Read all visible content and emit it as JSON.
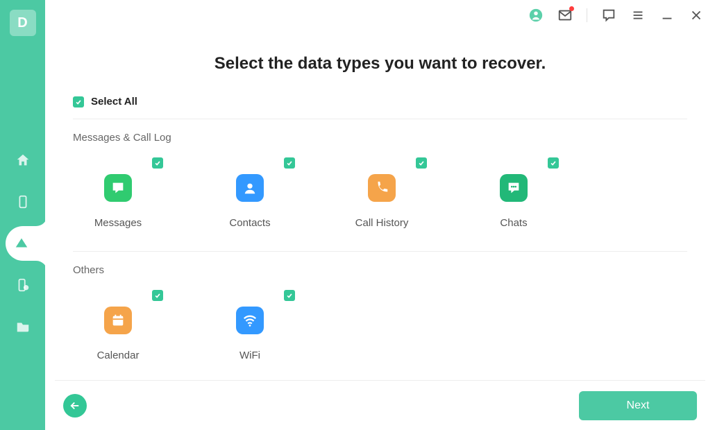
{
  "logo": "D",
  "page_title": "Select the data types you want to recover.",
  "select_all_label": "Select All",
  "next_label": "Next",
  "colors": {
    "brand": "#4cc9a3",
    "green_icon": "#30cb70",
    "blue_icon": "#3399ff",
    "orange_icon": "#f5a44a",
    "dark_green_icon": "#22b878"
  },
  "sections": [
    {
      "title": "Messages & Call Log",
      "items": [
        {
          "label": "Messages"
        },
        {
          "label": "Contacts"
        },
        {
          "label": "Call History"
        },
        {
          "label": "Chats"
        }
      ]
    },
    {
      "title": "Others",
      "items": [
        {
          "label": "Calendar"
        },
        {
          "label": "WiFi"
        }
      ]
    }
  ]
}
